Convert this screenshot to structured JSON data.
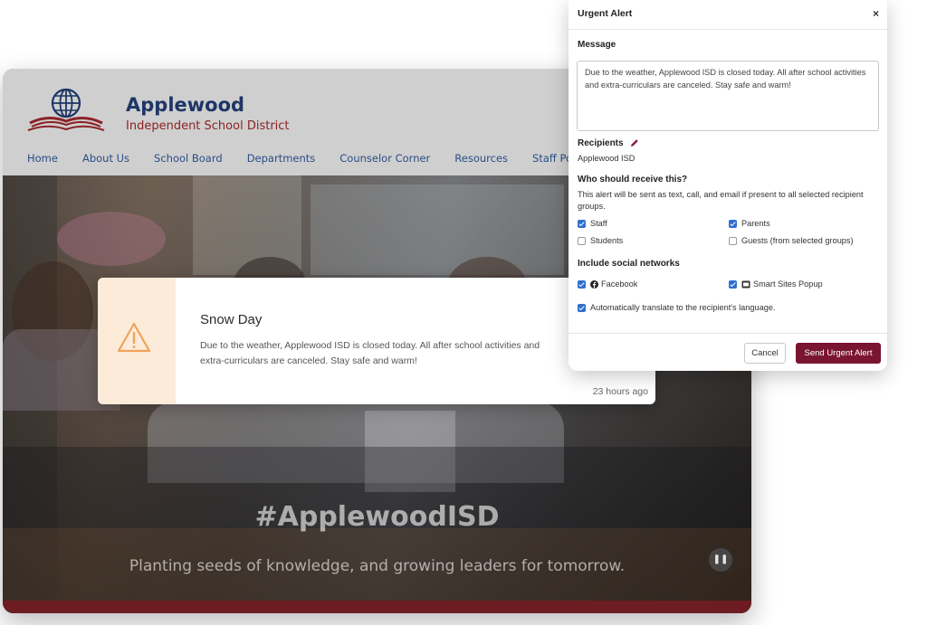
{
  "website": {
    "brand_name": "Applewood",
    "brand_subtitle": "Independent School District",
    "nav": [
      "Home",
      "About Us",
      "School Board",
      "Departments",
      "Counselor Corner",
      "Resources",
      "Staff Portal"
    ],
    "hero_title": "#ApplewoodISD",
    "hero_tagline": "Planting seeds of knowledge, and growing leaders for tomorrow.",
    "pause_icon": "pause-icon",
    "colors": {
      "brand_blue": "#1d3566",
      "brand_red": "#8b2226",
      "footer_bar": "#6d1d22"
    }
  },
  "alert_banner": {
    "icon": "warning-icon",
    "title": "Snow Day",
    "body": "Due to the weather, Applewood ISD is closed today. All after school activities and extra-curriculars are canceled. Stay safe and warm!",
    "time": "23 hours ago",
    "accent": "#fdebd9"
  },
  "urgent_panel": {
    "title": "Urgent Alert",
    "close": "×",
    "message_label": "Message",
    "message_value": "Due to the weather, Applewood ISD is closed today. All after school activities and extra-curriculars are canceled. Stay safe and warm!",
    "recipients_label": "Recipients",
    "recipients_value": "Applewood ISD",
    "who_label": "Who should receive this?",
    "who_help": "This alert will be sent as text, call, and email if present to all selected recipient groups.",
    "groups": [
      {
        "label": "Staff",
        "checked": true
      },
      {
        "label": "Parents",
        "checked": true
      },
      {
        "label": "Students",
        "checked": false
      },
      {
        "label": "Guests (from selected groups)",
        "checked": false
      }
    ],
    "social_label": "Include social networks",
    "networks": [
      {
        "label": "Facebook",
        "checked": true,
        "icon": "facebook-icon"
      },
      {
        "label": "Smart Sites Popup",
        "checked": true,
        "icon": "popup-icon"
      }
    ],
    "translate": {
      "label": "Automatically translate to the recipient's language.",
      "checked": true
    },
    "cancel_label": "Cancel",
    "send_label": "Send Urgent Alert",
    "colors": {
      "send_button": "#7a1530",
      "checkbox": "#2f6fce"
    }
  }
}
